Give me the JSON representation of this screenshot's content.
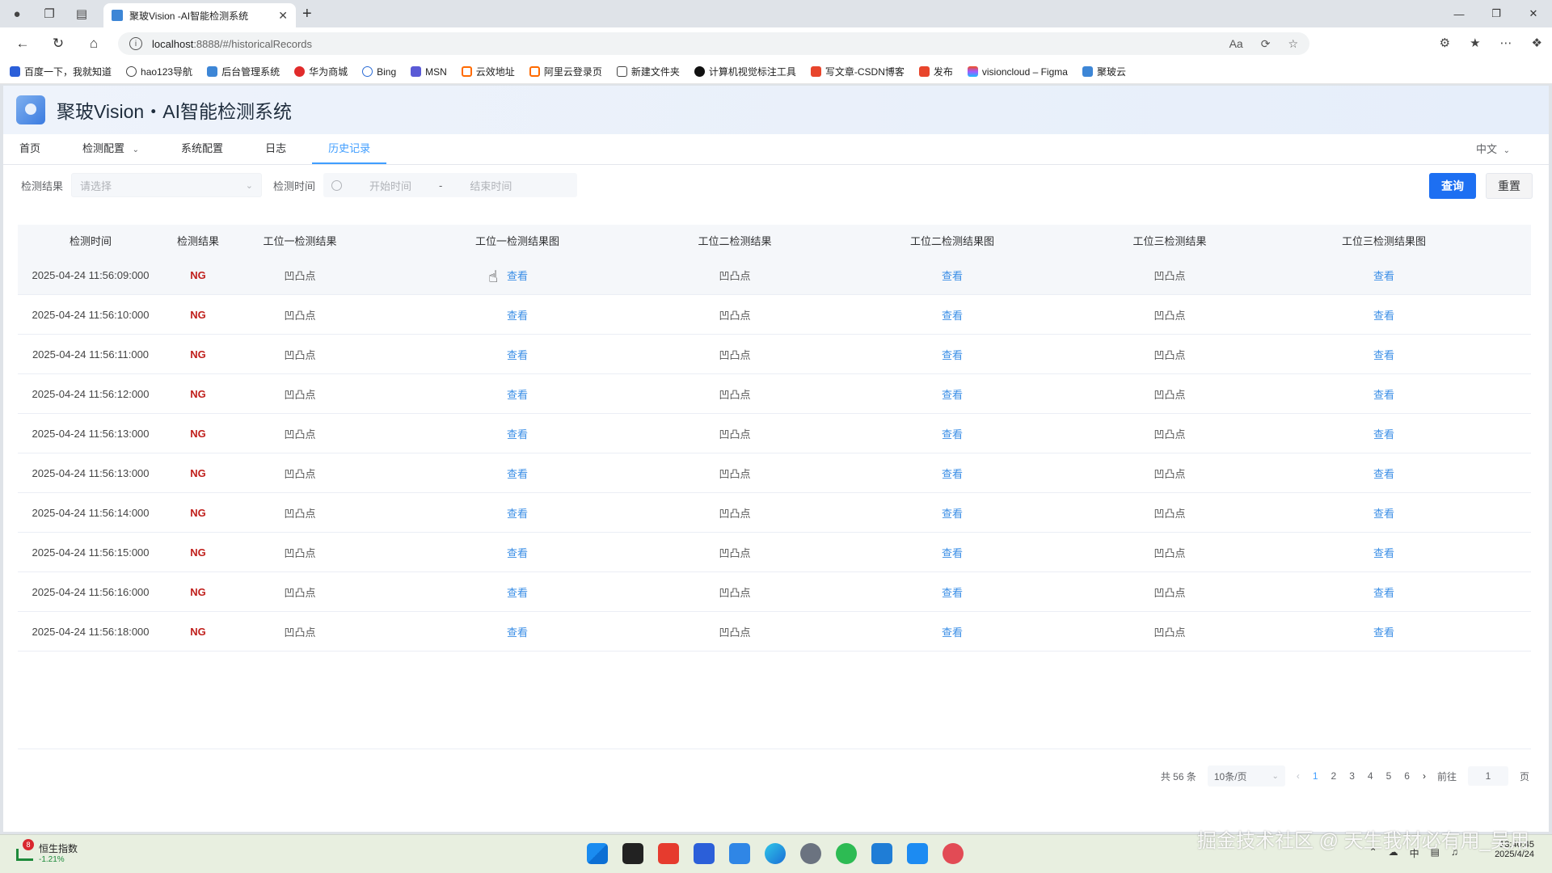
{
  "browser": {
    "tab_title": "聚玻Vision -AI智能检测系统",
    "url_host": "localhost",
    "url_rest": ":8888/#/historicalRecords",
    "bookmarks": [
      "百度一下，我就知道",
      "hao123导航",
      "后台管理系统",
      "华为商城",
      "Bing",
      "MSN",
      "云效地址",
      "阿里云登录页",
      "新建文件夹",
      "计算机视觉标注工具",
      "写文章-CSDN博客",
      "发布",
      "visioncloud – Figma",
      "聚玻云"
    ]
  },
  "app": {
    "title": "聚玻Vision・AI智能检测系统",
    "menu": [
      "首页",
      "检测配置",
      "系统配置",
      "日志",
      "历史记录"
    ],
    "language": "中文"
  },
  "filters": {
    "result_label": "检测结果",
    "result_placeholder": "请选择",
    "time_label": "检测时间",
    "start_placeholder": "开始时间",
    "separator": "-",
    "end_placeholder": "结束时间",
    "query_button": "查询",
    "reset_button": "重置"
  },
  "table": {
    "headers": [
      "检测时间",
      "检测结果",
      "工位一检测结果",
      "工位一检测结果图",
      "工位二检测结果",
      "工位二检测结果图",
      "工位三检测结果",
      "工位三检测结果图"
    ],
    "rows": [
      {
        "time": "2025-04-24 11:56:09:000",
        "result": "NG",
        "s1": "凹凸点",
        "s1img": "查看",
        "s2": "凹凸点",
        "s2img": "查看",
        "s3": "凹凸点",
        "s3img": "查看"
      },
      {
        "time": "2025-04-24 11:56:10:000",
        "result": "NG",
        "s1": "凹凸点",
        "s1img": "查看",
        "s2": "凹凸点",
        "s2img": "查看",
        "s3": "凹凸点",
        "s3img": "查看"
      },
      {
        "time": "2025-04-24 11:56:11:000",
        "result": "NG",
        "s1": "凹凸点",
        "s1img": "查看",
        "s2": "凹凸点",
        "s2img": "查看",
        "s3": "凹凸点",
        "s3img": "查看"
      },
      {
        "time": "2025-04-24 11:56:12:000",
        "result": "NG",
        "s1": "凹凸点",
        "s1img": "查看",
        "s2": "凹凸点",
        "s2img": "查看",
        "s3": "凹凸点",
        "s3img": "查看"
      },
      {
        "time": "2025-04-24 11:56:13:000",
        "result": "NG",
        "s1": "凹凸点",
        "s1img": "查看",
        "s2": "凹凸点",
        "s2img": "查看",
        "s3": "凹凸点",
        "s3img": "查看"
      },
      {
        "time": "2025-04-24 11:56:13:000",
        "result": "NG",
        "s1": "凹凸点",
        "s1img": "查看",
        "s2": "凹凸点",
        "s2img": "查看",
        "s3": "凹凸点",
        "s3img": "查看"
      },
      {
        "time": "2025-04-24 11:56:14:000",
        "result": "NG",
        "s1": "凹凸点",
        "s1img": "查看",
        "s2": "凹凸点",
        "s2img": "查看",
        "s3": "凹凸点",
        "s3img": "查看"
      },
      {
        "time": "2025-04-24 11:56:15:000",
        "result": "NG",
        "s1": "凹凸点",
        "s1img": "查看",
        "s2": "凹凸点",
        "s2img": "查看",
        "s3": "凹凸点",
        "s3img": "查看"
      },
      {
        "time": "2025-04-24 11:56:16:000",
        "result": "NG",
        "s1": "凹凸点",
        "s1img": "查看",
        "s2": "凹凸点",
        "s2img": "查看",
        "s3": "凹凸点",
        "s3img": "查看"
      },
      {
        "time": "2025-04-24 11:56:18:000",
        "result": "NG",
        "s1": "凹凸点",
        "s1img": "查看",
        "s2": "凹凸点",
        "s2img": "查看",
        "s3": "凹凸点",
        "s3img": "查看"
      }
    ]
  },
  "pagination": {
    "total": "共 56 条",
    "page_size": "10条/页",
    "pages": [
      "1",
      "2",
      "3",
      "4",
      "5",
      "6"
    ],
    "current": "1",
    "goto_label": "前往",
    "goto_value": "1",
    "page_suffix": "页"
  },
  "taskbar": {
    "stock_badge": "8",
    "stock_name": "恒生指数",
    "stock_change": "-1.21%",
    "time": "13:40:45",
    "date": "2025/4/24",
    "ime": "中",
    "watermark": "掘金技术社区 @ 天生我材必有用_吴用"
  }
}
